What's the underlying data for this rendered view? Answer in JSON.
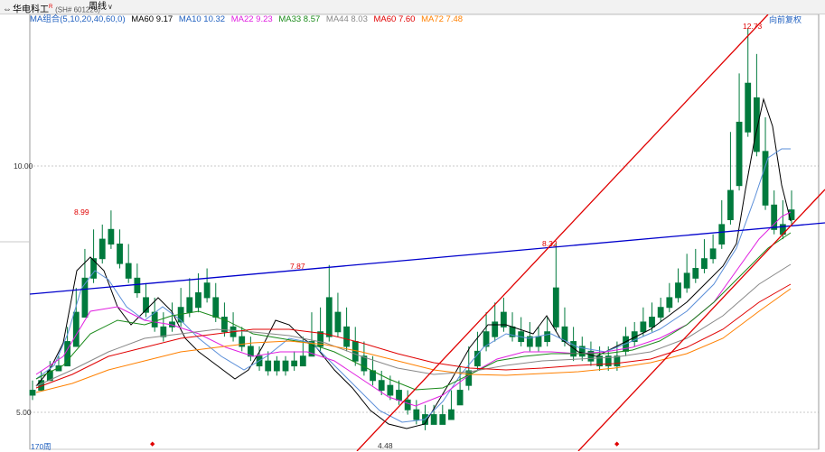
{
  "toolbar": {
    "stock_name": "华电科工",
    "stock_sup": "R",
    "stock_code": "(SH# 601226)",
    "period": "周线"
  },
  "legend": [
    {
      "label": "MA组合(5,10,20,40,60,0)",
      "color": "#1f5fbf"
    },
    {
      "label": "MA60 9.17",
      "color": "#000000"
    },
    {
      "label": "MA10 10.32",
      "color": "#1f5fbf"
    },
    {
      "label": "MA22 9.23",
      "color": "#e020e0"
    },
    {
      "label": "MA33 8.57",
      "color": "#1a8a1a"
    },
    {
      "label": "MA44 8.03",
      "color": "#888888"
    },
    {
      "label": "MA60 7.60",
      "color": "#e00000"
    },
    {
      "label": "MA72 7.48",
      "color": "#ff8000"
    }
  ],
  "rights_label": "向前复权",
  "axis": {
    "top_label": "10.00",
    "bottom_label": "5.00"
  },
  "annotations": {
    "high1": "8.99",
    "high2": "7.87",
    "high3": "8.32",
    "peak": "12.73",
    "low": "4.48"
  },
  "period_count": "170周",
  "colors": {
    "up": "#e00000",
    "down": "#007a3d",
    "trend_red": "#e00000",
    "trend_blue": "#0000cc"
  },
  "chart_data": {
    "type": "candlestick",
    "price_range": [
      4.2,
      12.9
    ],
    "period_count": "170周",
    "candles": [
      [
        5.3,
        5.5,
        5.2,
        5.1
      ],
      [
        5.5,
        5.7,
        5.3,
        5.3
      ],
      [
        5.7,
        5.9,
        5.5,
        5.5
      ],
      [
        5.8,
        6.0,
        5.7,
        5.7
      ],
      [
        6.3,
        6.6,
        5.8,
        5.8
      ],
      [
        6.9,
        7.4,
        6.2,
        6.3
      ],
      [
        7.6,
        8.2,
        6.8,
        6.9
      ],
      [
        8.0,
        8.6,
        7.6,
        7.5
      ],
      [
        8.4,
        8.7,
        8.0,
        7.9
      ],
      [
        8.6,
        8.99,
        8.3,
        8.2
      ],
      [
        8.3,
        8.6,
        7.9,
        7.8
      ],
      [
        7.9,
        8.3,
        7.6,
        7.5
      ],
      [
        7.6,
        7.9,
        7.3,
        7.2
      ],
      [
        7.2,
        7.5,
        6.9,
        6.8
      ],
      [
        6.9,
        7.2,
        6.6,
        6.5
      ],
      [
        6.6,
        6.9,
        6.4,
        6.3
      ],
      [
        6.7,
        7.1,
        6.6,
        6.5
      ],
      [
        7.0,
        7.4,
        6.7,
        6.6
      ],
      [
        7.2,
        7.6,
        6.9,
        6.8
      ],
      [
        7.3,
        7.7,
        7.0,
        6.9
      ],
      [
        7.5,
        7.8,
        7.2,
        7.1
      ],
      [
        7.2,
        7.5,
        6.8,
        6.7
      ],
      [
        6.8,
        7.1,
        6.5,
        6.4
      ],
      [
        6.6,
        6.9,
        6.4,
        6.3
      ],
      [
        6.4,
        6.6,
        6.2,
        6.1
      ],
      [
        6.2,
        6.4,
        6.0,
        5.9
      ],
      [
        6.0,
        6.2,
        5.8,
        5.7
      ],
      [
        5.9,
        6.1,
        5.7,
        5.6
      ],
      [
        5.9,
        6.0,
        5.7,
        5.6
      ],
      [
        5.9,
        6.0,
        5.7,
        5.6
      ],
      [
        5.9,
        6.1,
        5.8,
        5.7
      ],
      [
        6.0,
        6.4,
        5.8,
        5.8
      ],
      [
        6.3,
        6.9,
        6.0,
        6.0
      ],
      [
        6.5,
        7.0,
        6.2,
        6.1
      ],
      [
        7.2,
        7.87,
        6.4,
        6.3
      ],
      [
        6.9,
        7.3,
        6.5,
        6.4
      ],
      [
        6.6,
        7.0,
        6.2,
        6.1
      ],
      [
        6.3,
        6.6,
        5.9,
        5.8
      ],
      [
        6.0,
        6.3,
        5.7,
        5.6
      ],
      [
        5.7,
        6.0,
        5.5,
        5.4
      ],
      [
        5.5,
        5.7,
        5.3,
        5.2
      ],
      [
        5.4,
        5.6,
        5.2,
        5.1
      ],
      [
        5.3,
        5.5,
        5.1,
        5.0
      ],
      [
        5.1,
        5.3,
        4.9,
        4.8
      ],
      [
        4.9,
        5.1,
        4.7,
        4.6
      ],
      [
        4.8,
        5.0,
        4.6,
        4.48
      ],
      [
        4.8,
        5.0,
        4.6,
        4.6
      ],
      [
        4.8,
        5.0,
        4.6,
        4.6
      ],
      [
        4.9,
        5.3,
        4.7,
        4.7
      ],
      [
        5.3,
        5.8,
        5.0,
        5.0
      ],
      [
        5.7,
        6.2,
        5.4,
        5.3
      ],
      [
        6.1,
        6.5,
        5.8,
        5.7
      ],
      [
        6.5,
        6.9,
        6.2,
        6.1
      ],
      [
        6.7,
        7.1,
        6.4,
        6.3
      ],
      [
        6.9,
        7.2,
        6.6,
        6.5
      ],
      [
        6.6,
        6.9,
        6.4,
        6.3
      ],
      [
        6.5,
        6.8,
        6.3,
        6.2
      ],
      [
        6.4,
        6.7,
        6.2,
        6.1
      ],
      [
        6.4,
        6.6,
        6.2,
        6.1
      ],
      [
        6.5,
        6.8,
        6.3,
        6.2
      ],
      [
        7.4,
        8.32,
        6.6,
        6.5
      ],
      [
        6.6,
        7.0,
        6.3,
        6.2
      ],
      [
        6.3,
        6.6,
        6.0,
        5.9
      ],
      [
        6.2,
        6.4,
        6.0,
        5.9
      ],
      [
        6.1,
        6.3,
        5.9,
        5.8
      ],
      [
        6.0,
        6.2,
        5.8,
        5.7
      ],
      [
        6.0,
        6.2,
        5.8,
        5.7
      ],
      [
        6.0,
        6.3,
        5.8,
        5.7
      ],
      [
        6.4,
        6.6,
        6.1,
        6.0
      ],
      [
        6.5,
        6.7,
        6.3,
        6.2
      ],
      [
        6.7,
        7.0,
        6.5,
        6.4
      ],
      [
        6.8,
        7.1,
        6.6,
        6.5
      ],
      [
        7.0,
        7.2,
        6.8,
        6.7
      ],
      [
        7.2,
        7.5,
        7.0,
        6.9
      ],
      [
        7.5,
        7.8,
        7.2,
        7.1
      ],
      [
        7.7,
        8.1,
        7.4,
        7.3
      ],
      [
        7.8,
        8.2,
        7.6,
        7.5
      ],
      [
        8.0,
        8.4,
        7.8,
        7.7
      ],
      [
        8.2,
        8.5,
        8.0,
        7.9
      ],
      [
        8.7,
        9.2,
        8.3,
        8.2
      ],
      [
        9.4,
        10.6,
        8.8,
        8.7
      ],
      [
        10.8,
        11.8,
        9.5,
        9.4
      ],
      [
        11.6,
        12.73,
        10.6,
        10.5
      ],
      [
        11.3,
        12.2,
        10.2,
        10.1
      ],
      [
        10.2,
        10.9,
        9.1,
        9.0
      ],
      [
        9.1,
        9.4,
        8.6,
        8.5
      ],
      [
        8.7,
        9.2,
        8.5,
        8.4
      ],
      [
        9.0,
        9.4,
        8.8,
        8.7
      ]
    ]
  }
}
